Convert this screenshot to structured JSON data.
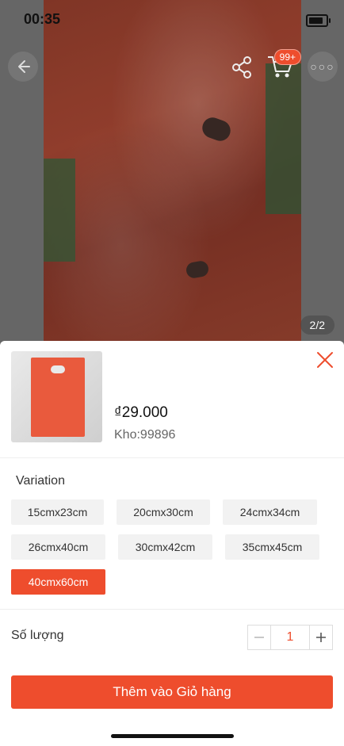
{
  "status_bar": {
    "time": "00:35"
  },
  "product_image": {
    "page_indicator": "2/2"
  },
  "header": {
    "cart_badge": "99+"
  },
  "sheet": {
    "price": "₫29.000",
    "stock": "Kho:99896",
    "variation_title": "Variation",
    "variations": [
      {
        "label": "15cmx23cm",
        "selected": false
      },
      {
        "label": "20cmx30cm",
        "selected": false
      },
      {
        "label": "24cmx34cm",
        "selected": false
      },
      {
        "label": "26cmx40cm",
        "selected": false
      },
      {
        "label": "30cmx42cm",
        "selected": false
      },
      {
        "label": "35cmx45cm",
        "selected": false
      },
      {
        "label": "40cmx60cm",
        "selected": true
      }
    ],
    "quantity_label": "Số lượng",
    "quantity_value": "1",
    "add_to_cart_label": "Thêm vào Giỏ hàng"
  },
  "colors": {
    "accent": "#ee4d2d"
  },
  "icons": [
    "back-arrow-icon",
    "share-icon",
    "cart-icon",
    "more-icon",
    "close-icon",
    "minus-icon",
    "plus-icon"
  ]
}
